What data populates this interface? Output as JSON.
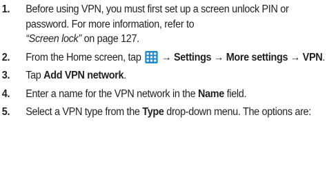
{
  "steps": [
    {
      "number": "1.",
      "text_a": "Before using VPN, you must first set up a screen unlock PIN or password. For more information, refer to",
      "text_ref": "“Screen lock”",
      "text_b": " on page 127."
    },
    {
      "number": "2.",
      "text_a": "From the Home screen, tap ",
      "icon": "apps-grid-icon",
      "arrow1": " → ",
      "settings": "Settings",
      "arrow2": " → ",
      "more_settings": "More settings",
      "arrow3": " → ",
      "vpn": "VPN",
      "end": "."
    },
    {
      "number": "3.",
      "text_a": "Tap ",
      "bold": "Add VPN network",
      "end": "."
    },
    {
      "number": "4.",
      "text_a": "Enter a name for the VPN network in the ",
      "bold": "Name",
      "text_b": " field."
    },
    {
      "number": "5.",
      "text_a": "Select a VPN type from the ",
      "bold": "Type",
      "text_b": " drop-down menu. The options are:"
    }
  ],
  "colors": {
    "text": "#231f20",
    "icon_blue": "#1e88c8"
  }
}
